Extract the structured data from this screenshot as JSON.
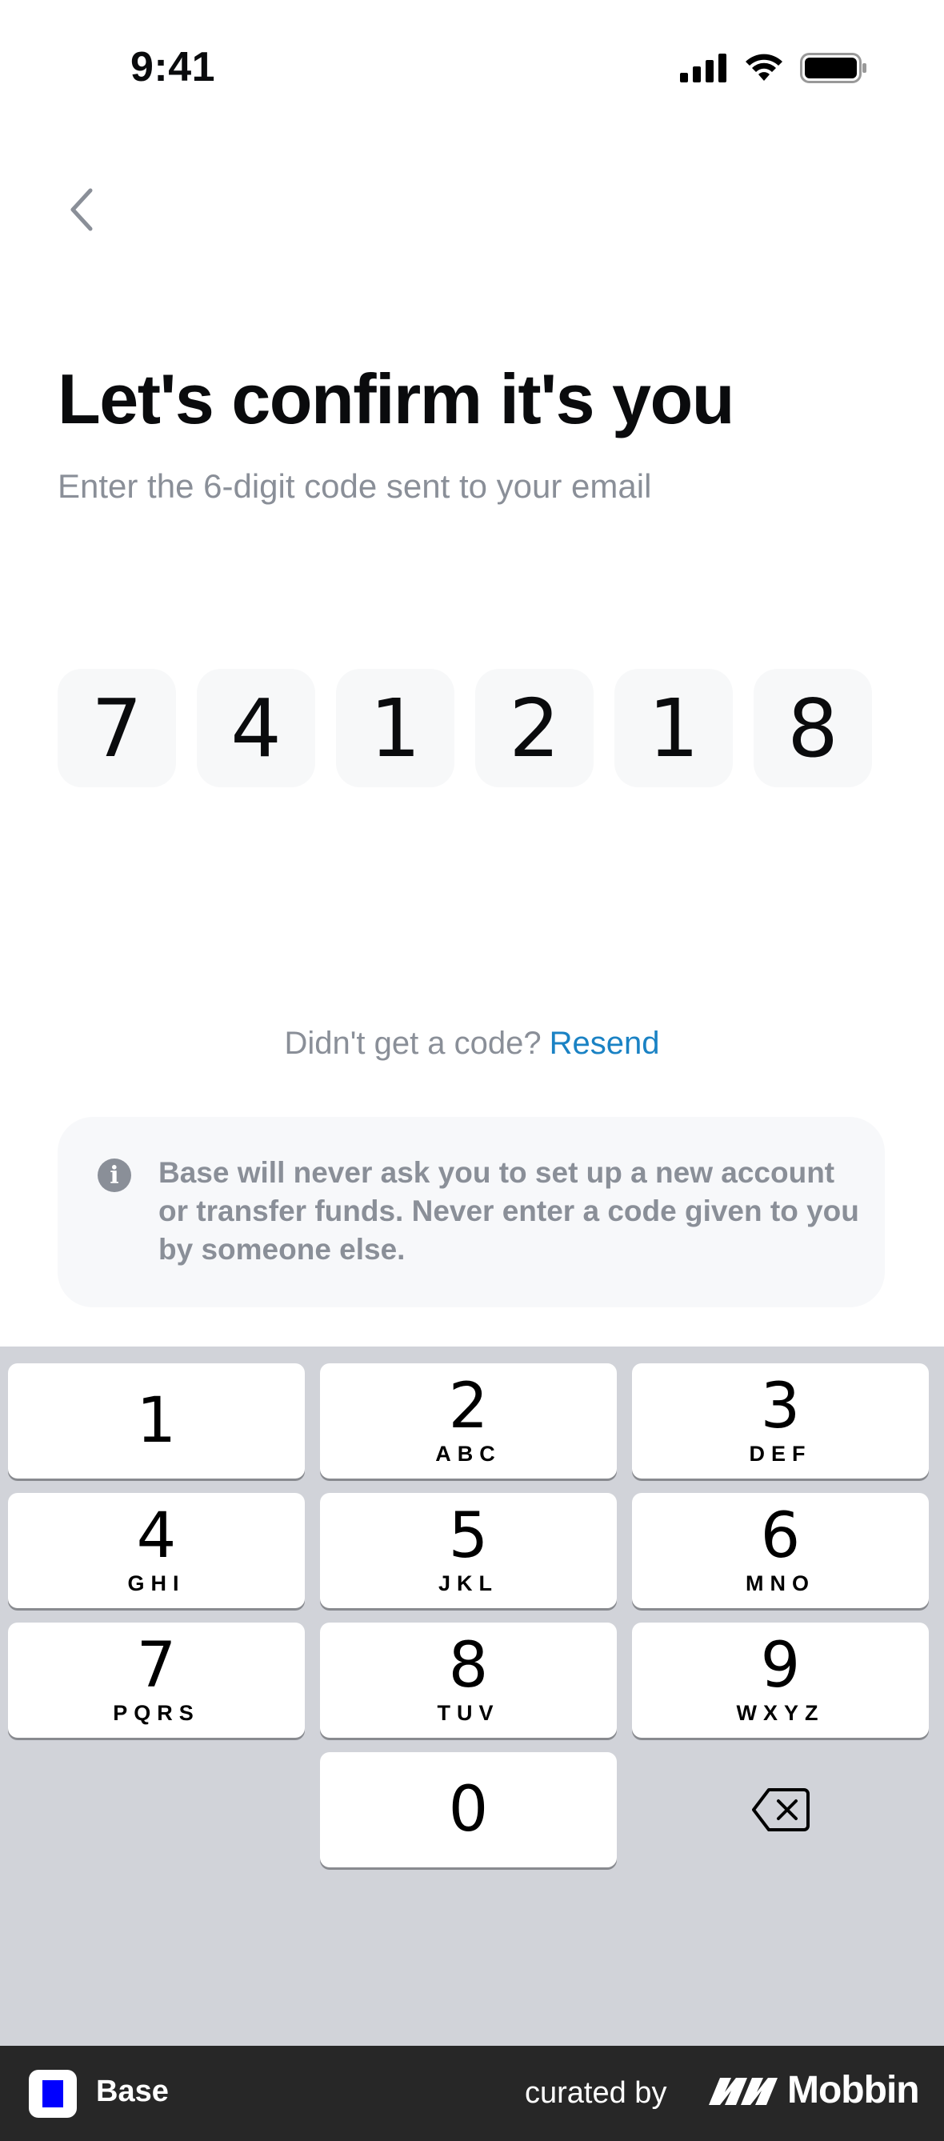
{
  "status_bar": {
    "time": "9:41"
  },
  "header": {
    "title": "Let's confirm it's you",
    "subtitle": "Enter the 6-digit code sent to your email"
  },
  "code": {
    "digits": [
      "7",
      "4",
      "1",
      "2",
      "1",
      "8"
    ]
  },
  "resend": {
    "prompt": "Didn't get a code?",
    "link": "Resend"
  },
  "notice": {
    "icon": "info-icon",
    "text": "Base will never ask you to set up a new account or transfer funds. Never enter a code given to you by someone else."
  },
  "keypad": {
    "keys": [
      {
        "num": "1",
        "letters": ""
      },
      {
        "num": "2",
        "letters": "ABC"
      },
      {
        "num": "3",
        "letters": "DEF"
      },
      {
        "num": "4",
        "letters": "GHI"
      },
      {
        "num": "5",
        "letters": "JKL"
      },
      {
        "num": "6",
        "letters": "MNO"
      },
      {
        "num": "7",
        "letters": "PQRS"
      },
      {
        "num": "8",
        "letters": "TUV"
      },
      {
        "num": "9",
        "letters": "WXYZ"
      },
      {
        "num": "0",
        "letters": ""
      }
    ],
    "delete_icon": "backspace-icon"
  },
  "footer": {
    "app_name": "Base",
    "curated_by": "curated by",
    "brand": "Mobbin"
  }
}
